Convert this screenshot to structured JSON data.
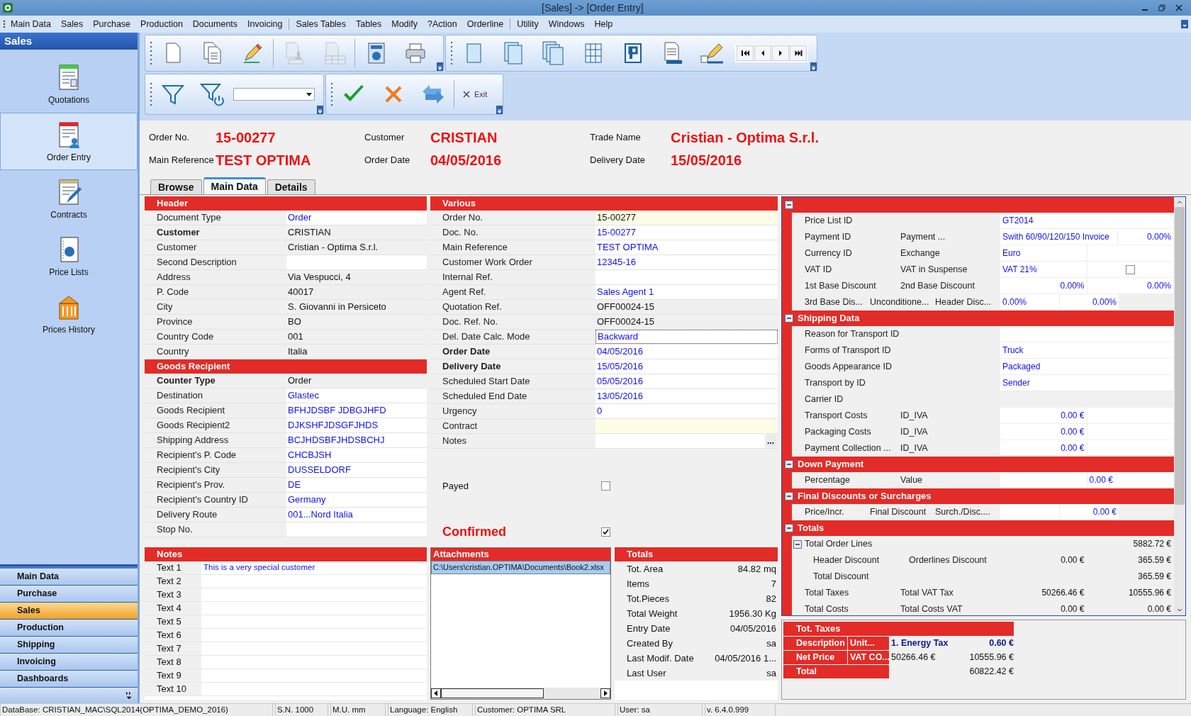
{
  "window": {
    "title": "[Sales] -> [Order Entry]"
  },
  "menu": [
    "Main Data",
    "Sales",
    "Purchase",
    "Production",
    "Documents",
    "Invoicing",
    "Sales Tables",
    "Tables",
    "Modify",
    "?Action",
    "Orderline",
    "Utility",
    "Windows",
    "Help"
  ],
  "sidebar": {
    "title": "Sales",
    "items": [
      {
        "label": "Quotations",
        "selected": false
      },
      {
        "label": "Order Entry",
        "selected": true
      },
      {
        "label": "Contracts",
        "selected": false
      },
      {
        "label": "Price Lists",
        "selected": false
      },
      {
        "label": "Prices History",
        "selected": false
      }
    ],
    "groups": [
      {
        "label": "Main Data",
        "selected": false
      },
      {
        "label": "Purchase",
        "selected": false
      },
      {
        "label": "Sales",
        "selected": true
      },
      {
        "label": "Production",
        "selected": false
      },
      {
        "label": "Shipping",
        "selected": false
      },
      {
        "label": "Invoicing",
        "selected": false
      },
      {
        "label": "Dashboards",
        "selected": false
      }
    ]
  },
  "toolbar": {
    "main": [
      {
        "disabled": false
      },
      {
        "disabled": false
      },
      {
        "disabled": false
      },
      {
        "disabled": true
      },
      {
        "disabled": true
      },
      {
        "disabled": false
      },
      {
        "disabled": false
      }
    ],
    "view": [
      {
        "disabled": false
      },
      {
        "disabled": false
      },
      {
        "disabled": false
      },
      {
        "disabled": false
      },
      {
        "disabled": false
      },
      {
        "disabled": false
      },
      {
        "disabled": false
      }
    ],
    "exit_label": "Exit"
  },
  "header_fields": [
    {
      "label": "Order No.",
      "value": "15-00277"
    },
    {
      "label": "Customer",
      "value": "CRISTIAN"
    },
    {
      "label": "Trade Name",
      "value": "Cristian - Optima S.r.l."
    },
    {
      "label": "Main Reference",
      "value": "TEST OPTIMA"
    },
    {
      "label": "Order Date",
      "value": "04/05/2016"
    },
    {
      "label": "Delivery Date",
      "value": "15/05/2016"
    }
  ],
  "tabs": [
    {
      "label": "Browse",
      "selected": false
    },
    {
      "label": "Main Data",
      "selected": true
    },
    {
      "label": "Details",
      "selected": false
    }
  ],
  "header": {
    "title": "Header",
    "rows": [
      {
        "label": "Document Type",
        "value": "Order",
        "bold": false,
        "editable": true
      },
      {
        "label": "Customer",
        "value": "CRISTIAN",
        "bold": true,
        "editable": false
      },
      {
        "label": "Customer",
        "value": "Cristian - Optima S.r.l.",
        "bold": false,
        "editable": false
      },
      {
        "label": "Second Description",
        "bold": false,
        "editable": true
      },
      {
        "label": "Address",
        "value": "Via Vespucci, 4",
        "bold": false,
        "editable": false
      },
      {
        "label": "P. Code",
        "value": "40017",
        "bold": false,
        "editable": false
      },
      {
        "label": "City",
        "value": "S. Giovanni in Persiceto",
        "bold": false,
        "editable": false
      },
      {
        "label": "Province",
        "value": "BO",
        "bold": false,
        "editable": false
      },
      {
        "label": "Country Code",
        "value": "001",
        "bold": false,
        "editable": false
      },
      {
        "label": "Country",
        "value": "Italia",
        "bold": false,
        "editable": false
      }
    ]
  },
  "goods_recipient": {
    "title": "Goods Recipient",
    "rows": [
      {
        "label": "Counter Type",
        "value": "Order",
        "bold": true,
        "editable": false
      },
      {
        "label": "Destination",
        "value": "Glastec",
        "bold": false,
        "editable": true
      },
      {
        "label": "Goods Recipient",
        "value": "BFHJDSBF JDBGJHFD",
        "bold": false,
        "editable": true
      },
      {
        "label": "Goods Recipient2",
        "value": "DJKSHFJDSGFJHDS",
        "bold": false,
        "editable": true
      },
      {
        "label": "Shipping Address",
        "value": "BCJHDSBFJHDSBCHJ",
        "bold": false,
        "editable": true
      },
      {
        "label": "Recipient's P. Code",
        "value": "CHCBJSH",
        "bold": false,
        "editable": true
      },
      {
        "label": "Recipient's City",
        "value": "DUSSELDORF",
        "bold": false,
        "editable": true
      },
      {
        "label": "Recipient's Prov.",
        "value": "DE",
        "bold": false,
        "editable": true
      },
      {
        "label": "Recipient's Country ID",
        "value": "Germany",
        "bold": false,
        "editable": true
      },
      {
        "label": "Delivery Route",
        "value": "001...Nord Italia",
        "bold": false,
        "editable": true
      },
      {
        "label": "Stop No.",
        "bold": false,
        "editable": true
      }
    ]
  },
  "various": {
    "title": "Various",
    "rows": [
      {
        "kind": "field",
        "label": "Order No.",
        "value": "15-00277",
        "bold": false,
        "editable": false,
        "highlighted": true,
        "focused": false
      },
      {
        "kind": "field",
        "label": "Doc. No.",
        "value": "15-00277",
        "bold": false,
        "editable": true,
        "highlighted": false,
        "focused": false
      },
      {
        "kind": "field",
        "label": "Main Reference",
        "value": "TEST OPTIMA",
        "bold": false,
        "editable": true,
        "highlighted": false,
        "focused": false
      },
      {
        "kind": "field",
        "label": "Customer Work Order",
        "value": "12345-16",
        "bold": false,
        "editable": true,
        "highlighted": false,
        "focused": false
      },
      {
        "kind": "field",
        "label": "Internal Ref.",
        "bold": false,
        "editable": true,
        "highlighted": false,
        "focused": false
      },
      {
        "kind": "field",
        "label": "Agent Ref.",
        "value": "Sales Agent 1",
        "bold": false,
        "editable": true,
        "highlighted": false,
        "focused": false
      },
      {
        "kind": "field",
        "label": "Quotation Ref.",
        "value": "OFF00024-15",
        "bold": false,
        "editable": false,
        "highlighted": false,
        "focused": false
      },
      {
        "kind": "field",
        "label": "Doc. Ref. No.",
        "value": "OFF00024-15",
        "bold": false,
        "editable": false,
        "highlighted": false,
        "focused": false
      },
      {
        "kind": "field",
        "label": "Del. Date Calc. Mode",
        "value": "Backward",
        "bold": false,
        "editable": true,
        "highlighted": false,
        "focused": true
      },
      {
        "kind": "field",
        "label": "Order Date",
        "value": "04/05/2016",
        "bold": true,
        "editable": true,
        "highlighted": false,
        "focused": false
      },
      {
        "kind": "field",
        "label": "Delivery Date",
        "value": "15/05/2016",
        "bold": true,
        "editable": true,
        "highlighted": false,
        "focused": false
      },
      {
        "kind": "field",
        "label": "Scheduled Start Date",
        "value": "05/05/2016",
        "bold": false,
        "editable": true,
        "highlighted": false,
        "focused": false
      },
      {
        "kind": "field",
        "label": "Scheduled End Date",
        "value": "13/05/2016",
        "bold": false,
        "editable": true,
        "highlighted": false,
        "focused": false
      },
      {
        "kind": "field",
        "label": "Urgency",
        "value": "0",
        "bold": false,
        "editable": true,
        "highlighted": false,
        "focused": false
      },
      {
        "kind": "field",
        "label": "Contract",
        "bold": false,
        "editable": true,
        "highlighted": true,
        "focused": false
      },
      {
        "kind": "field",
        "label": "Notes",
        "button": "...",
        "bold": false,
        "editable": true,
        "highlighted": false,
        "focused": false
      },
      {
        "kind": "checkbox",
        "label": "Payed",
        "checked": false
      },
      {
        "kind": "status",
        "label": "Confirmed",
        "checked": true
      }
    ]
  },
  "details": {
    "sections": [
      {
        "expanded": true,
        "rows": [
          {
            "labels": [
              "Price List ID"
            ],
            "values": [
              {
                "kind": "link",
                "text": "GT2014"
              }
            ]
          },
          {
            "labels": [
              "Payment ID",
              "Payment ..."
            ],
            "values": [
              {
                "kind": "link",
                "text": "Swith 60/90/120/150  Invoice"
              },
              {
                "kind": "number",
                "text": "0.00%"
              }
            ]
          },
          {
            "labels": [
              "Currency ID",
              "Exchange"
            ],
            "values": [
              {
                "kind": "link",
                "text": "Euro"
              },
              {
                "kind": "blank"
              }
            ]
          },
          {
            "labels": [
              "VAT ID",
              "VAT in Suspense"
            ],
            "values": [
              {
                "kind": "link",
                "text": "VAT 21%"
              },
              {
                "kind": "checkbox",
                "checked": false
              }
            ]
          },
          {
            "labels": [
              "1st Base Discount",
              "2nd Base Discount"
            ],
            "values": [
              {
                "kind": "number",
                "text": "0.00%"
              },
              {
                "kind": "number",
                "text": "0.00%"
              }
            ]
          },
          {
            "labels": [
              "3rd Base Dis...",
              "Unconditione...",
              "Header Disc..."
            ],
            "values": [
              {
                "kind": "link",
                "text": "0.00%"
              },
              {
                "kind": "number",
                "text": "0.00%"
              }
            ]
          }
        ]
      },
      {
        "title": "Shipping Data",
        "expanded": true,
        "rows": [
          {
            "labels": [
              "Reason for Transport ID"
            ],
            "values": [
              {
                "kind": "blank"
              }
            ]
          },
          {
            "labels": [
              "Forms of Transport ID"
            ],
            "values": [
              {
                "kind": "link",
                "text": "Truck"
              }
            ]
          },
          {
            "labels": [
              "Goods Appearance ID"
            ],
            "values": [
              {
                "kind": "link",
                "text": "Packaged"
              }
            ]
          },
          {
            "labels": [
              "Transport by ID"
            ],
            "values": [
              {
                "kind": "link",
                "text": "Sender"
              }
            ]
          },
          {
            "labels": [
              "Carrier ID"
            ],
            "values": []
          },
          {
            "labels": [
              "Transport Costs",
              "ID_IVA"
            ],
            "values": [
              {
                "kind": "number",
                "text": "0.00 €"
              },
              {
                "kind": "blank"
              }
            ]
          },
          {
            "labels": [
              "Packaging Costs",
              "ID_IVA"
            ],
            "values": [
              {
                "kind": "number",
                "text": "0.00 €"
              },
              {
                "kind": "blank"
              }
            ]
          },
          {
            "labels": [
              "Payment Collection ...",
              "ID_IVA"
            ],
            "values": [
              {
                "kind": "number",
                "text": "0.00 €"
              },
              {
                "kind": "blank"
              }
            ]
          }
        ]
      },
      {
        "title": "Down Payment",
        "expanded": true,
        "rows": [
          {
            "labels": [
              "Percentage",
              "Value"
            ],
            "values": [
              {
                "kind": "blank"
              },
              {
                "kind": "link",
                "text": "0.00 €"
              }
            ]
          }
        ]
      },
      {
        "title": "Final Discounts or Surcharges",
        "expanded": true,
        "rows": [
          {
            "labels": [
              "Price/Incr.",
              "Final Discount",
              "Surch./Disc...."
            ],
            "values": [
              {
                "kind": "blank"
              },
              {
                "kind": "number",
                "text": "0.00 €"
              }
            ]
          }
        ]
      },
      {
        "title": "Totals",
        "expanded": true,
        "rows": [
          {
            "labels": [
              "Total Order Lines"
            ],
            "values": [
              {
                "kind": "amount",
                "text": "5882.72 €"
              }
            ],
            "expanded": true,
            "children": [
              {
                "labels": [
                  "Header Discount",
                  "Orderlines Discount"
                ],
                "values": [
                  {
                    "kind": "amount",
                    "text": "0.00 €"
                  },
                  {
                    "kind": "amount",
                    "text": "365.59 €"
                  }
                ]
              },
              {
                "labels": [
                  "Total Discount"
                ],
                "values": [
                  {
                    "kind": "amount",
                    "text": "365.59 €"
                  }
                ]
              }
            ]
          },
          {
            "labels": [
              "Total Taxes",
              "Total VAT Tax"
            ],
            "values": [
              {
                "kind": "amount",
                "text": "50266.46 €"
              },
              {
                "kind": "amount",
                "text": "10555.96 €"
              }
            ]
          },
          {
            "labels": [
              "Total Costs",
              "Total Costs VAT"
            ],
            "values": [
              {
                "kind": "amount",
                "text": "0.00 €"
              },
              {
                "kind": "amount",
                "text": "0.00 €"
              }
            ]
          }
        ]
      }
    ]
  },
  "tot_taxes": {
    "title": "Tot. Taxes",
    "rows": [
      {
        "headers": [
          "Description",
          "Unit..."
        ],
        "values": [
          "1. Energy Tax",
          "0.60 €"
        ],
        "bold": true
      },
      {
        "headers": [
          "Net Price",
          "VAT CO..."
        ],
        "values": [
          "50266.46 €",
          "10555.96 €"
        ],
        "bold": false
      },
      {
        "headers": [
          "Total"
        ],
        "values": [
          "60822.42 €"
        ],
        "bold": false
      }
    ]
  },
  "notes": {
    "title": "Notes",
    "rows": [
      {
        "label": "Text 1",
        "value": "This is a very special customer"
      },
      {
        "label": "Text 2"
      },
      {
        "label": "Text 3"
      },
      {
        "label": "Text 4"
      },
      {
        "label": "Text 5"
      },
      {
        "label": "Text 6"
      },
      {
        "label": "Text 7"
      },
      {
        "label": "Text 8"
      },
      {
        "label": "Text 9"
      },
      {
        "label": "Text 10"
      }
    ]
  },
  "attachments": {
    "title": "Attachments",
    "items": [
      {
        "label": "C:\\Users\\cristian.OPTIMA\\Documents\\Book2.xlsx",
        "selected": true
      }
    ]
  },
  "totals": {
    "title": "Totals",
    "rows": [
      {
        "label": "Tot. Area",
        "value": "84.82 mq"
      },
      {
        "label": "Items",
        "value": "7"
      },
      {
        "label": "Tot.Pieces",
        "value": "82"
      },
      {
        "label": "Total Weight",
        "value": "1956.30 Kg"
      },
      {
        "label": "Entry Date",
        "value": "04/05/2016"
      },
      {
        "label": "Created By",
        "value": "sa"
      },
      {
        "label": "Last Modif. Date",
        "value": "04/05/2016 1..."
      },
      {
        "label": "Last User",
        "value": "sa"
      }
    ]
  },
  "status_bar": [
    "DataBase: CRISTIAN_MAC\\SQL2014(OPTIMA_DEMO_2016)",
    "S.N. 1000",
    "M.U. mm",
    "Language: English",
    "Customer: OPTIMA SRL",
    "User: sa",
    "v. 6.4.0.999"
  ]
}
